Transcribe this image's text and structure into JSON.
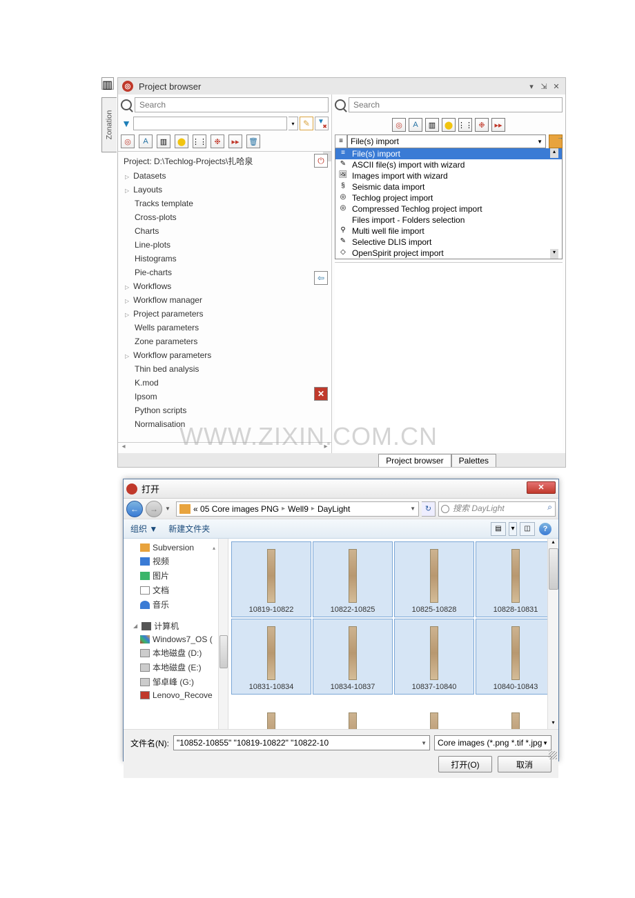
{
  "panel": {
    "title": "Project browser",
    "sidebar_tab": "Zonation",
    "search_placeholder": "Search",
    "project_path": "Project: D:\\Techlog-Projects\\扎哈泉",
    "tree": [
      {
        "label": "Datasets",
        "expandable": true
      },
      {
        "label": "Layouts",
        "expandable": true
      },
      {
        "label": "Tracks template",
        "expandable": false
      },
      {
        "label": "Cross-plots",
        "expandable": false
      },
      {
        "label": "Charts",
        "expandable": false
      },
      {
        "label": "Line-plots",
        "expandable": false
      },
      {
        "label": "Histograms",
        "expandable": false
      },
      {
        "label": "Pie-charts",
        "expandable": false
      },
      {
        "label": "Workflows",
        "expandable": true
      },
      {
        "label": "Workflow manager",
        "expandable": true
      },
      {
        "label": "Project parameters",
        "expandable": true
      },
      {
        "label": "Wells parameters",
        "expandable": false
      },
      {
        "label": "Zone parameters",
        "expandable": false
      },
      {
        "label": "Workflow parameters",
        "expandable": true
      },
      {
        "label": "Thin bed analysis",
        "expandable": false
      },
      {
        "label": "K.mod",
        "expandable": false
      },
      {
        "label": "Ipsom",
        "expandable": false
      },
      {
        "label": "Python scripts",
        "expandable": false
      },
      {
        "label": "Normalisation",
        "expandable": false
      }
    ],
    "tabs": {
      "browser": "Project browser",
      "palettes": "Palettes"
    }
  },
  "import": {
    "selected": "File(s) import",
    "menu": [
      "File(s) import",
      "ASCII file(s) import with wizard",
      "Images import with wizard",
      "Seismic data import",
      "Techlog project import",
      "Compressed Techlog project import",
      "Files import - Folders selection",
      "Multi well file import",
      "Selective DLIS import",
      "OpenSpirit project import"
    ]
  },
  "dialog": {
    "title": "打开",
    "breadcrumb": {
      "prefix": "«",
      "p1": "05 Core images PNG",
      "p2": "Well9",
      "p3": "DayLight"
    },
    "search_placeholder": "搜索 DayLight",
    "toolbar": {
      "organize": "组织 ▼",
      "newfolder": "新建文件夹"
    },
    "tree": {
      "libs": [
        "Subversion",
        "视频",
        "图片",
        "文档",
        "音乐"
      ],
      "computer_label": "计算机",
      "drives": [
        "Windows7_OS (",
        "本地磁盘 (D:)",
        "本地磁盘 (E:)",
        "邹卓峰 (G:)",
        "Lenovo_Recove"
      ]
    },
    "files": [
      "10819-10822",
      "10822-10825",
      "10825-10828",
      "10828-10831",
      "10831-10834",
      "10834-10837",
      "10837-10840",
      "10840-10843",
      "",
      "",
      "",
      ""
    ],
    "filename_label": "文件名(N):",
    "filename_value": "\"10852-10855\" \"10819-10822\" \"10822-10",
    "filter": "Core images (*.png *.tif *.jpg",
    "open_btn": "打开(O)",
    "cancel_btn": "取消"
  },
  "watermark": "WWW.ZIXIN.COM.CN"
}
